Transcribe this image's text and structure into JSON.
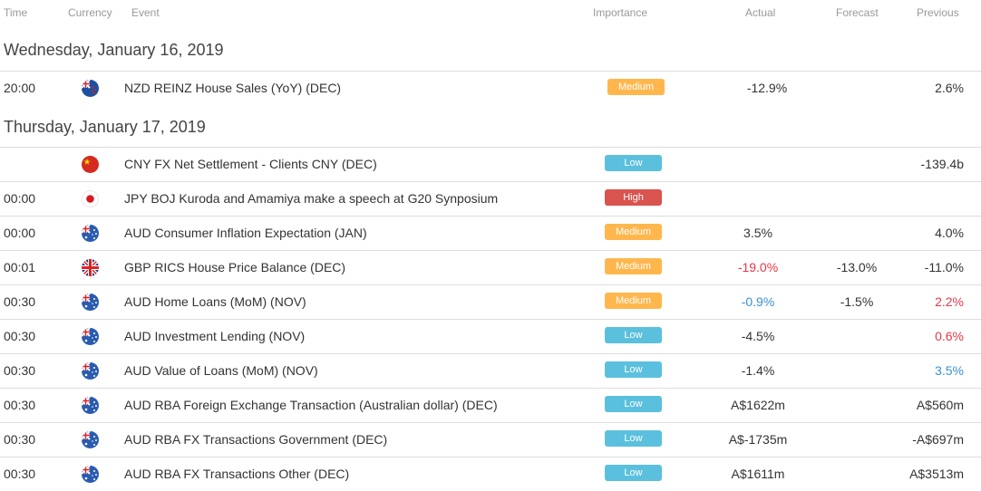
{
  "columns": {
    "time": "Time",
    "currency": "Currency",
    "event": "Event",
    "importance": "Importance",
    "actual": "Actual",
    "forecast": "Forecast",
    "previous": "Previous"
  },
  "colors": {
    "medium": "#ffb74d",
    "low": "#5bc0de",
    "high": "#d9534f",
    "negative_surprise": "#e8374a",
    "positive_surprise": "#3a8fd9"
  },
  "sections": [
    {
      "date": "Wednesday, January 16, 2019",
      "events": [
        {
          "time": "20:00",
          "currency": "NZD",
          "flag": "new-zealand-flag-icon",
          "event": "NZD REINZ House Sales (YoY) (DEC)",
          "importance": "Medium",
          "actual": "-12.9%",
          "forecast": "",
          "previous": "2.6%",
          "actual_color": "",
          "previous_color": ""
        }
      ]
    },
    {
      "date": "Thursday, January 17, 2019",
      "events": [
        {
          "time": "",
          "currency": "CNY",
          "flag": "china-flag-icon",
          "event": "CNY FX Net Settlement - Clients CNY (DEC)",
          "importance": "Low",
          "actual": "",
          "forecast": "",
          "previous": "-139.4b",
          "actual_color": "",
          "previous_color": ""
        },
        {
          "time": "00:00",
          "currency": "JPY",
          "flag": "japan-flag-icon",
          "event": "JPY BOJ Kuroda and Amamiya make a speech at G20 Synposium",
          "importance": "High",
          "actual": "",
          "forecast": "",
          "previous": "",
          "actual_color": "",
          "previous_color": ""
        },
        {
          "time": "00:00",
          "currency": "AUD",
          "flag": "australia-flag-icon",
          "event": "AUD Consumer Inflation Expectation (JAN)",
          "importance": "Medium",
          "actual": "3.5%",
          "forecast": "",
          "previous": "4.0%",
          "actual_color": "",
          "previous_color": ""
        },
        {
          "time": "00:01",
          "currency": "GBP",
          "flag": "uk-flag-icon",
          "event": "GBP RICS House Price Balance (DEC)",
          "importance": "Medium",
          "actual": "-19.0%",
          "forecast": "-13.0%",
          "previous": "-11.0%",
          "actual_color": "red",
          "previous_color": ""
        },
        {
          "time": "00:30",
          "currency": "AUD",
          "flag": "australia-flag-icon",
          "event": "AUD Home Loans (MoM) (NOV)",
          "importance": "Medium",
          "actual": "-0.9%",
          "forecast": "-1.5%",
          "previous": "2.2%",
          "actual_color": "blue",
          "previous_color": "red"
        },
        {
          "time": "00:30",
          "currency": "AUD",
          "flag": "australia-flag-icon",
          "event": "AUD Investment Lending (NOV)",
          "importance": "Low",
          "actual": "-4.5%",
          "forecast": "",
          "previous": "0.6%",
          "actual_color": "",
          "previous_color": "red"
        },
        {
          "time": "00:30",
          "currency": "AUD",
          "flag": "australia-flag-icon",
          "event": "AUD Value of Loans (MoM) (NOV)",
          "importance": "Low",
          "actual": "-1.4%",
          "forecast": "",
          "previous": "3.5%",
          "actual_color": "",
          "previous_color": "blue"
        },
        {
          "time": "00:30",
          "currency": "AUD",
          "flag": "australia-flag-icon",
          "event": "AUD RBA Foreign Exchange Transaction (Australian dollar) (DEC)",
          "importance": "Low",
          "actual": "A$1622m",
          "forecast": "",
          "previous": "A$560m",
          "actual_color": "",
          "previous_color": ""
        },
        {
          "time": "00:30",
          "currency": "AUD",
          "flag": "australia-flag-icon",
          "event": "AUD RBA FX Transactions Government (DEC)",
          "importance": "Low",
          "actual": "A$-1735m",
          "forecast": "",
          "previous": "-A$697m",
          "actual_color": "",
          "previous_color": ""
        },
        {
          "time": "00:30",
          "currency": "AUD",
          "flag": "australia-flag-icon",
          "event": "AUD RBA FX Transactions Other (DEC)",
          "importance": "Low",
          "actual": "A$1611m",
          "forecast": "",
          "previous": "A$3513m",
          "actual_color": "",
          "previous_color": ""
        }
      ]
    }
  ]
}
